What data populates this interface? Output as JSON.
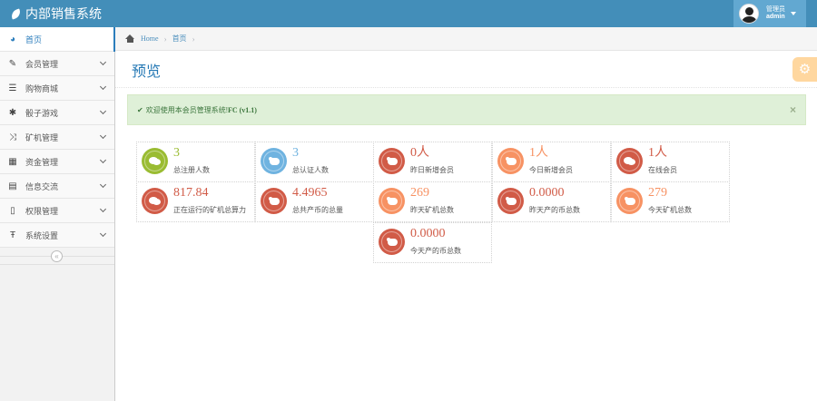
{
  "app": {
    "title": "内部销售系统"
  },
  "user": {
    "role": "管理员",
    "name": "admin"
  },
  "sidebar": {
    "items": [
      {
        "label": "首页",
        "icon": "dashboard-icon",
        "glyph": "◕",
        "active": true
      },
      {
        "label": "会员管理",
        "icon": "pencil-square-icon",
        "glyph": "✎"
      },
      {
        "label": "购物商城",
        "icon": "list-icon",
        "glyph": "☰"
      },
      {
        "label": "骰子游戏",
        "icon": "asterisk-icon",
        "glyph": "✱"
      },
      {
        "label": "矿机管理",
        "icon": "random-icon",
        "glyph": "⤨"
      },
      {
        "label": "资金管理",
        "icon": "calendar-icon",
        "glyph": "▦"
      },
      {
        "label": "信息交流",
        "icon": "list-alt-icon",
        "glyph": "▤"
      },
      {
        "label": "权限管理",
        "icon": "file-icon",
        "glyph": "▯"
      },
      {
        "label": "系统设置",
        "icon": "text-width-icon",
        "glyph": "Ŧ"
      }
    ],
    "collapse_glyph": "«"
  },
  "breadcrumb": {
    "home": "Home",
    "current": "首页",
    "sep": "›"
  },
  "page": {
    "title": "预览",
    "settings_glyph": "⚙"
  },
  "alert": {
    "check": "✔",
    "text": "欢迎使用本会员管理系统!",
    "version": " FC (v1.1)",
    "close": "×"
  },
  "stats": [
    {
      "value": "3",
      "label": "总注册人数",
      "color": "green",
      "icon": "comments-icon"
    },
    {
      "value": "3",
      "label": "总认证人数",
      "color": "blue",
      "icon": "twitter-icon"
    },
    {
      "value": "0人",
      "label": "昨日新增会员",
      "color": "red",
      "icon": "twitter-icon"
    },
    {
      "value": "1人",
      "label": "今日新增会员",
      "color": "orange",
      "icon": "twitter-icon"
    },
    {
      "value": "1人",
      "label": "在线会员",
      "color": "red",
      "icon": "comments-icon"
    },
    {
      "value": "817.84",
      "label": "正在运行的矿机总算力",
      "color": "red",
      "icon": "comments-icon"
    },
    {
      "value": "4.4965",
      "label": "总共产币的总量",
      "color": "red",
      "icon": "twitter-icon"
    },
    {
      "value": "269",
      "label": "昨天矿机总数",
      "color": "orange",
      "icon": "twitter-icon"
    },
    {
      "value": "0.0000",
      "label": "昨天产的币总数",
      "color": "red",
      "icon": "twitter-icon"
    },
    {
      "value": "279",
      "label": "今天矿机总数",
      "color": "orange",
      "icon": "twitter-icon"
    },
    {
      "value": "0.0000",
      "label": "今天产的币总数",
      "color": "red",
      "icon": "twitter-icon"
    }
  ],
  "colors": {
    "navbar": "#438eb9",
    "green": "#9abc32",
    "blue": "#6fb3e0",
    "red": "#d15b47",
    "orange": "#f79263"
  }
}
